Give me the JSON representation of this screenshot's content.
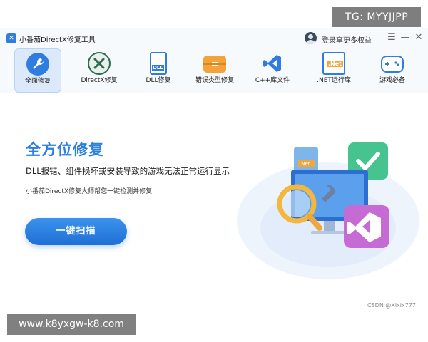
{
  "window": {
    "title": "小番茄DirectX修复工具",
    "login": "登录享更多权益",
    "controls": [
      "☰",
      "—",
      "✕"
    ]
  },
  "toolbar": {
    "items": [
      {
        "label": "全面修复",
        "icon": "wrench-icon",
        "active": true
      },
      {
        "label": "DirectX修复",
        "icon": "directx-icon",
        "active": false
      },
      {
        "label": "DLL修复",
        "icon": "dll-file-icon",
        "active": false
      },
      {
        "label": "错误类型修复",
        "icon": "toolbox-icon",
        "active": false
      },
      {
        "label": "C++库文件",
        "icon": "visual-studio-icon",
        "active": false
      },
      {
        "label": ".NET运行库",
        "icon": "dotnet-icon",
        "active": false
      },
      {
        "label": "游戏必备",
        "icon": "gamepad-icon",
        "active": false
      }
    ],
    "dll_badge": "DLL",
    "net_badge": ".Net"
  },
  "main": {
    "title": "全方位修复",
    "subtitle": "DLL报错、组件损坏或安装导致的游戏无法正常运行显示",
    "description": "小番茄DirectX修复大师帮您一键检测并修复",
    "scan_button": "一键扫描",
    "illus_badge": ".Net"
  },
  "watermarks": {
    "top": "TG: MYYJJPP",
    "bottom": "www.k8yxgw-k8.com",
    "csdn": "CSDN @Xixix777"
  },
  "colors": {
    "accent": "#2a7fe0",
    "button": "#1f6fd6"
  }
}
